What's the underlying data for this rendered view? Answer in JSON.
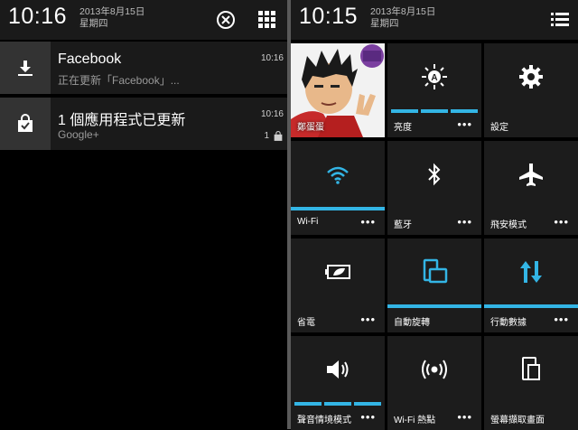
{
  "left": {
    "clock": "10:16",
    "date_line1": "2013年8月15日",
    "date_line2": "星期四",
    "notifications": [
      {
        "title": "Facebook",
        "subtitle": "正在更新「Facebook」...",
        "time": "10:16",
        "icon": "download-icon"
      },
      {
        "title": "1 個應用程式已更新",
        "subtitle": "Google+",
        "time": "10:16",
        "count": "1",
        "icon": "shopping-bag-icon"
      }
    ]
  },
  "right": {
    "clock": "10:15",
    "date_line1": "2013年8月15日",
    "date_line2": "星期四",
    "tiles": [
      {
        "label": "鄭蛋蛋",
        "icon": "avatar-image",
        "has_more": false
      },
      {
        "label": "亮度",
        "icon": "brightness-auto-icon",
        "has_more": true,
        "more": "•••",
        "bar": "three-segment"
      },
      {
        "label": "設定",
        "icon": "gear-icon",
        "has_more": false
      },
      {
        "label": "Wi-Fi",
        "icon": "wifi-icon",
        "has_more": true,
        "more": "•••",
        "active": true
      },
      {
        "label": "藍牙",
        "icon": "bluetooth-icon",
        "has_more": true,
        "more": "•••"
      },
      {
        "label": "飛安模式",
        "icon": "airplane-icon",
        "has_more": true,
        "more": "•••"
      },
      {
        "label": "省電",
        "icon": "battery-saver-icon",
        "has_more": true,
        "more": "•••"
      },
      {
        "label": "自動旋轉",
        "icon": "auto-rotate-icon",
        "has_more": false,
        "active": true
      },
      {
        "label": "行動數據",
        "icon": "mobile-data-icon",
        "has_more": true,
        "more": "•••",
        "active": true
      },
      {
        "label": "聲音情境模式",
        "icon": "volume-icon",
        "has_more": true,
        "more": "•••",
        "bar": "three-segment"
      },
      {
        "label": "Wi-Fi 熱點",
        "icon": "wifi-hotspot-icon",
        "has_more": true,
        "more": "•••"
      },
      {
        "label": "螢幕擷取畫面",
        "icon": "screenshot-icon",
        "has_more": false
      }
    ]
  },
  "colors": {
    "accent": "#33b5e5",
    "tile_bg": "#1c1c1c",
    "divider": "#5a5a5a"
  }
}
